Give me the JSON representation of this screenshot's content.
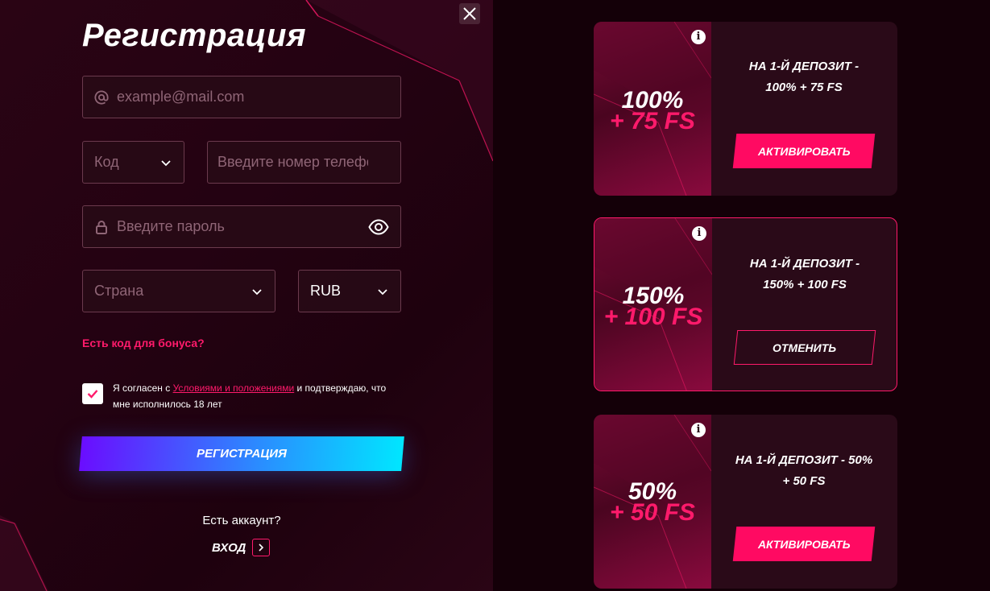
{
  "form": {
    "title": "Регистрация",
    "email_placeholder": "example@mail.com",
    "code_placeholder": "Код",
    "phone_placeholder": "Введите номер телефона",
    "password_placeholder": "Введите пароль",
    "country_placeholder": "Страна",
    "currency_value": "RUB",
    "bonus_code_link": "Есть код для бонуса?",
    "agree_prefix": "Я согласен с ",
    "agree_link": "Условиями и положениями",
    "agree_suffix": " и подтверждаю, что мне исполнилось 18 лет",
    "register_button": "РЕГИСТРАЦИЯ",
    "has_account": "Есть аккаунт?",
    "login_label": "ВХОД"
  },
  "bonuses": [
    {
      "percent": "100%",
      "fs": "+ 75 FS",
      "desc_line1": "НА 1-Й ДЕПОЗИТ -",
      "desc_line2": "100% + 75 FS",
      "button": "АКТИВИРОВАТЬ",
      "selected": false
    },
    {
      "percent": "150%",
      "fs": "+ 100 FS",
      "desc_line1": "НА 1-Й ДЕПОЗИТ -",
      "desc_line2": "150% + 100 FS",
      "button": "ОТМЕНИТЬ",
      "selected": true
    },
    {
      "percent": "50%",
      "fs": "+ 50 FS",
      "desc_line1": "НА 1-Й ДЕПОЗИТ - 50%",
      "desc_line2": "+ 50 FS",
      "button": "АКТИВИРОВАТЬ",
      "selected": false
    }
  ],
  "icons": {
    "close": "close-icon",
    "email": "at-icon",
    "lock": "lock-icon",
    "eye": "eye-icon",
    "chevron": "chevron-down-icon",
    "info": "info-icon",
    "arrow": "chevron-right-icon",
    "check": "check-icon"
  },
  "colors": {
    "accent": "#ff1a6b",
    "activate_button": "#ff0a62",
    "register_gradient_start": "#6a0dff",
    "register_gradient_end": "#00e6ff"
  }
}
